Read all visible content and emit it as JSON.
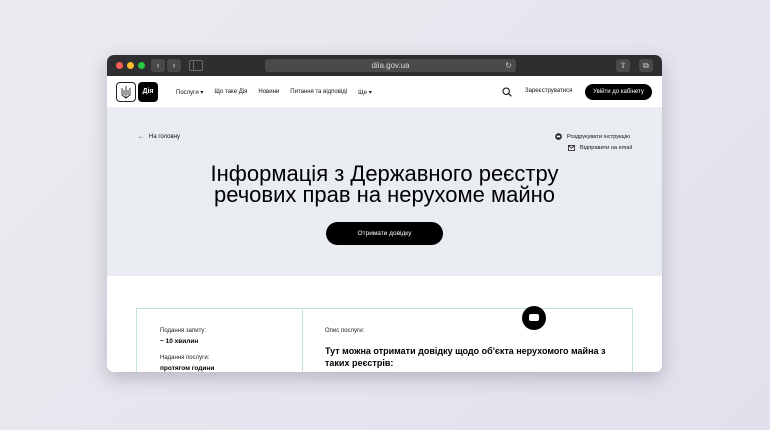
{
  "browser": {
    "url": "diia.gov.ua",
    "colors": {
      "red": "#ff5f57",
      "yellow": "#febc2e",
      "green": "#28c840"
    }
  },
  "header": {
    "logo_text": "Дія",
    "nav": [
      "Послуги ▾",
      "Що таке Дія",
      "Новини",
      "Питання та відповіді",
      "Ще ▾"
    ],
    "register": "Зареєструватися",
    "login": "Увійти до кабінету"
  },
  "hero": {
    "back": "На головну",
    "print": "Роздрукувати інструкцію",
    "email": "Відправити на email",
    "title_line1": "Інформація з Державного реєстру",
    "title_line2": "речових прав на нерухоме майно",
    "cta": "Отримати довідку"
  },
  "card": {
    "request_label": "Подання запиту:",
    "request_value": "~ 10 хвилин",
    "service_label": "Надання послуги:",
    "service_value": "протягом години",
    "desc_label": "Опис послуги:",
    "desc_line1": "Тут можна отримати довідку щодо об'єкта нерухомого майна з",
    "desc_line2": "таких реєстрів:"
  }
}
